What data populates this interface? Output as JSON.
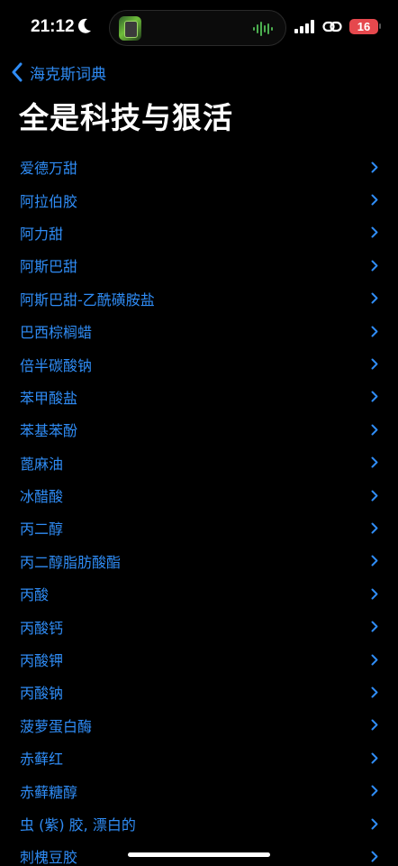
{
  "status_bar": {
    "time": "21:12",
    "battery": "16",
    "icons": [
      "moon-icon",
      "signal-icon",
      "link-icon",
      "battery-icon"
    ]
  },
  "nav": {
    "back_label": "海克斯词典",
    "title": "全是科技与狠活"
  },
  "colors": {
    "accent": "#2f8cf5",
    "background": "#000000",
    "battery": "#e5484d"
  },
  "list": {
    "items": [
      "爱德万甜",
      "阿拉伯胶",
      "阿力甜",
      "阿斯巴甜",
      "阿斯巴甜-乙酰磺胺盐",
      "巴西棕榈蜡",
      "倍半碳酸钠",
      "苯甲酸盐",
      "苯基苯酚",
      "蓖麻油",
      "冰醋酸",
      "丙二醇",
      "丙二醇脂肪酸酯",
      "丙酸",
      "丙酸钙",
      "丙酸钾",
      "丙酸钠",
      "菠萝蛋白酶",
      "赤藓红",
      "赤藓糖醇",
      "虫 (紫) 胶, 漂白的",
      "刺槐豆胶"
    ]
  }
}
